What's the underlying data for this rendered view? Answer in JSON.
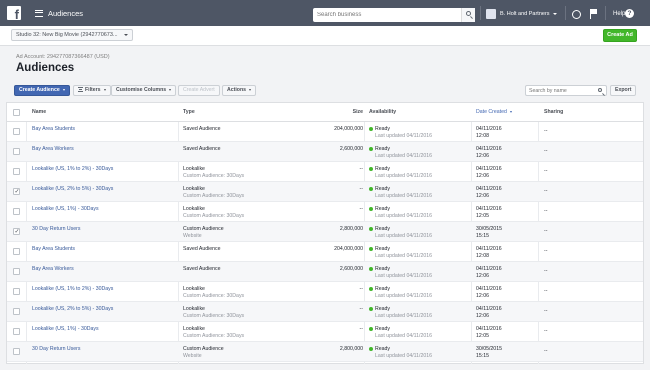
{
  "topbar": {
    "title": "Audiences",
    "search_placeholder": "Search business",
    "account_name": "B. Holt and Partners",
    "help_label": "Help",
    "help_icon_glyph": "?"
  },
  "subbar": {
    "ad_account_select": "Studio 32: New Big Movie (2942770673...",
    "create_ad_label": "Create Ad"
  },
  "header": {
    "account_label": "Ad Account: 294277087366487 (USD)",
    "title": "Audiences"
  },
  "toolbar": {
    "create_audience": "Create Audience",
    "filters": "Filters",
    "customise_columns": "Customise Columns",
    "create_advert": "Create Advert",
    "actions": "Actions",
    "search_placeholder": "Search by name",
    "export": "Export"
  },
  "table": {
    "columns": {
      "name": "Name",
      "type": "Type",
      "size": "Size",
      "availability": "Availability",
      "date_created": "Date Created",
      "sharing": "Sharing"
    },
    "rows": [
      {
        "name": "Bay Area Students",
        "type": "Saved Audience",
        "type_sub": "",
        "size": "204,000,000",
        "status": "Ready",
        "updated": "Last updated 04/11/2016",
        "date": "04/11/2016",
        "time": "12:08",
        "sharing": "--",
        "checked": false
      },
      {
        "name": "Bay Area Workers",
        "type": "Saved Audience",
        "type_sub": "",
        "size": "2,600,000",
        "status": "Ready",
        "updated": "Last updated 04/11/2016",
        "date": "04/11/2016",
        "time": "12:06",
        "sharing": "--",
        "checked": false
      },
      {
        "name": "Lookalike (US, 1% to 2%) - 30Days",
        "type": "Lookalike",
        "type_sub": "Custom Audience: 30Days",
        "size": "--",
        "status": "Ready",
        "updated": "Last updated 04/11/2016",
        "date": "04/11/2016",
        "time": "12:06",
        "sharing": "--",
        "checked": false
      },
      {
        "name": "Lookalike (US, 2% to 5%) - 30Days",
        "type": "Lookalike",
        "type_sub": "Custom Audience: 30Days",
        "size": "--",
        "status": "Ready",
        "updated": "Last updated 04/11/2016",
        "date": "04/11/2016",
        "time": "12:06",
        "sharing": "--",
        "checked": true
      },
      {
        "name": "Lookalike (US, 1%) - 30Days",
        "type": "Lookalike",
        "type_sub": "Custom Audience: 30Days",
        "size": "--",
        "status": "Ready",
        "updated": "Last updated 04/11/2016",
        "date": "04/11/2016",
        "time": "12:05",
        "sharing": "--",
        "checked": false
      },
      {
        "name": "30 Day Return Users",
        "type": "Custom Audience",
        "type_sub": "Website",
        "size": "2,800,000",
        "status": "Ready",
        "updated": "Last updated 04/11/2016",
        "date": "30/05/2015",
        "time": "15:15",
        "sharing": "--",
        "checked": true
      },
      {
        "name": "Bay Area Students",
        "type": "Saved Audience",
        "type_sub": "",
        "size": "204,000,000",
        "status": "Ready",
        "updated": "Last updated 04/11/2016",
        "date": "04/11/2016",
        "time": "12:08",
        "sharing": "--",
        "checked": false
      },
      {
        "name": "Bay Area Workers",
        "type": "Saved Audience",
        "type_sub": "",
        "size": "2,600,000",
        "status": "Ready",
        "updated": "Last updated 04/11/2016",
        "date": "04/11/2016",
        "time": "12:06",
        "sharing": "--",
        "checked": false
      },
      {
        "name": "Lookalike (US, 1% to 2%) - 30Days",
        "type": "Lookalike",
        "type_sub": "Custom Audience: 30Days",
        "size": "--",
        "status": "Ready",
        "updated": "Last updated 04/11/2016",
        "date": "04/11/2016",
        "time": "12:06",
        "sharing": "--",
        "checked": false
      },
      {
        "name": "Lookalike (US, 2% to 5%) - 30Days",
        "type": "Lookalike",
        "type_sub": "Custom Audience: 30Days",
        "size": "--",
        "status": "Ready",
        "updated": "Last updated 04/11/2016",
        "date": "04/11/2016",
        "time": "12:06",
        "sharing": "--",
        "checked": false
      },
      {
        "name": "Lookalike (US, 1%) - 30Days",
        "type": "Lookalike",
        "type_sub": "Custom Audience: 30Days",
        "size": "--",
        "status": "Ready",
        "updated": "Last updated 04/11/2016",
        "date": "04/11/2016",
        "time": "12:05",
        "sharing": "--",
        "checked": false
      },
      {
        "name": "30 Day Return Users",
        "type": "Custom Audience",
        "type_sub": "Website",
        "size": "2,800,000",
        "status": "Ready",
        "updated": "Last updated 04/11/2016",
        "date": "30/05/2015",
        "time": "15:15",
        "sharing": "--",
        "checked": false
      }
    ]
  },
  "colors": {
    "topbar": "#4e5665",
    "primary": "#4267b2",
    "create_ad": "#42b72a",
    "ready_dot": "#42b72a",
    "link": "#365899"
  }
}
